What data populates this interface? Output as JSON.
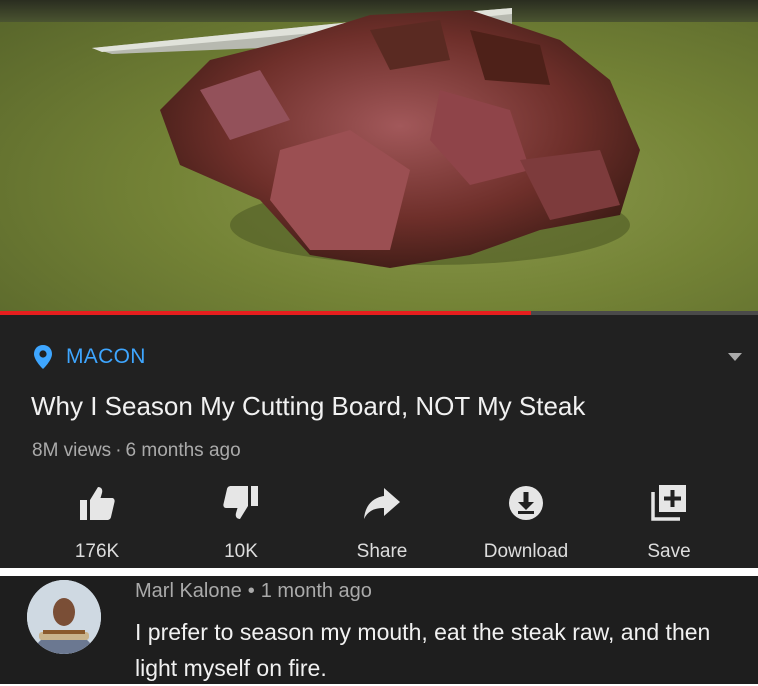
{
  "video": {
    "progress_fraction": 0.7,
    "accent_color": "#e61e1e"
  },
  "location": {
    "icon": "location-pin-icon",
    "label": "MACON",
    "color": "#3ea6ff"
  },
  "title": "Why I Season My Cutting Board, NOT My Steak",
  "meta": {
    "views": "8M views",
    "separator": "·",
    "age": "6 months ago"
  },
  "actions": [
    {
      "icon": "thumbs-up-icon",
      "label": "176K"
    },
    {
      "icon": "thumbs-down-icon",
      "label": "10K"
    },
    {
      "icon": "share-icon",
      "label": "Share"
    },
    {
      "icon": "download-icon",
      "label": "Download"
    },
    {
      "icon": "save-to-playlist-icon",
      "label": "Save"
    }
  ],
  "comment": {
    "author": "Marl Kalone",
    "separator": "•",
    "age": "1 month ago",
    "text": "I prefer to season my mouth, eat the steak raw, and then light myself on fire."
  }
}
